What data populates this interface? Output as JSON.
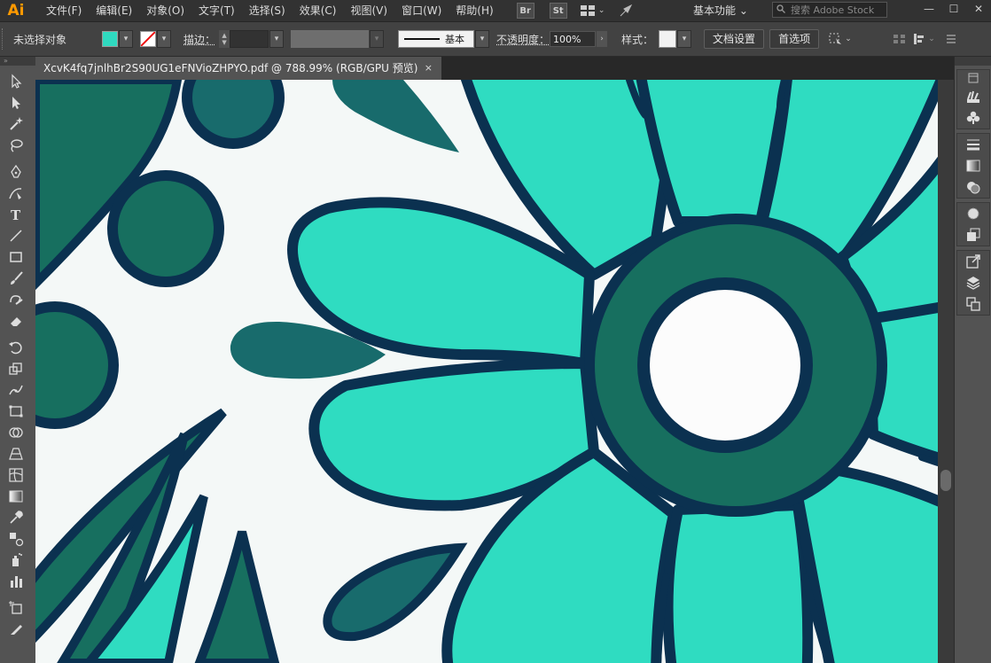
{
  "app": {
    "logo": "Ai",
    "menu": [
      "文件(F)",
      "编辑(E)",
      "对象(O)",
      "文字(T)",
      "选择(S)",
      "效果(C)",
      "视图(V)",
      "窗口(W)",
      "帮助(H)"
    ],
    "bridge_label": "Br",
    "stock_label": "St",
    "workspace": "基本功能",
    "search_placeholder": "搜索 Adobe Stock",
    "window_buttons": [
      "—",
      "☐",
      "✕"
    ]
  },
  "control_bar": {
    "selection_status": "未选择对象",
    "fill_color": "#2fd9bf",
    "stroke_label": "描边：",
    "stroke_style_label": "基本",
    "opacity_label": "不透明度：",
    "opacity_value": "100%",
    "style_label": "样式：",
    "doc_setup_button": "文档设置",
    "preferences_button": "首选项"
  },
  "document_tab": {
    "title": "XcvK4fq7jnlhBr2S90UG1eFNVioZHPYO.pdf  @  788.99%  (RGB/GPU 预览)",
    "close": "×"
  },
  "tools": [
    "selection-tool-icon",
    "direct-selection-tool-icon",
    "magic-wand-tool-icon",
    "lasso-tool-icon",
    "pen-tool-icon",
    "curvature-tool-icon",
    "type-tool-icon",
    "line-segment-tool-icon",
    "rectangle-tool-icon",
    "paintbrush-tool-icon",
    "shaper-tool-icon",
    "eraser-tool-icon",
    "rotate-tool-icon",
    "scale-tool-icon",
    "puppet-warp-tool-icon",
    "free-transform-tool-icon",
    "shape-builder-tool-icon",
    "perspective-grid-tool-icon",
    "mesh-tool-icon",
    "gradient-tool-icon",
    "eyedropper-tool-icon",
    "blend-tool-icon",
    "symbol-sprayer-tool-icon",
    "column-graph-tool-icon",
    "artboard-tool-icon",
    "slice-tool-icon"
  ],
  "artwork_colors": {
    "petal": "#2fdcc1",
    "outline": "#0b3150",
    "dark_teal": "#176f5f",
    "leaf_teal": "#186b6c",
    "center_fill": "#fcfcfc",
    "background": "#f4f8f7"
  },
  "right_panels": [
    "collapse-icon",
    "libraries-icon",
    "symbols-icon",
    "stroke-panel-icon",
    "gradient-panel-icon",
    "transparency-panel-icon",
    "appearance-panel-icon",
    "graphic-styles-icon",
    "export-icon",
    "layers-icon",
    "artboards-icon"
  ]
}
